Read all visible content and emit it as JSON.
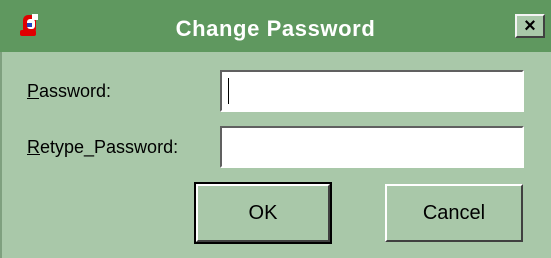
{
  "window": {
    "title": "Change Password",
    "close_label": "×"
  },
  "form": {
    "password_label_mnemonic": "P",
    "password_label_rest": "assword:",
    "password_value": "",
    "retype_label_mnemonic": "R",
    "retype_label_rest": "etype_Password:",
    "retype_value": ""
  },
  "buttons": {
    "ok_label": "OK",
    "cancel_label": "Cancel"
  },
  "icons": {
    "app_icon": "app-icon",
    "close_icon": "close-icon"
  },
  "colors": {
    "title_bar": "#5f985f",
    "dialog_bg": "#a9c8a9"
  }
}
